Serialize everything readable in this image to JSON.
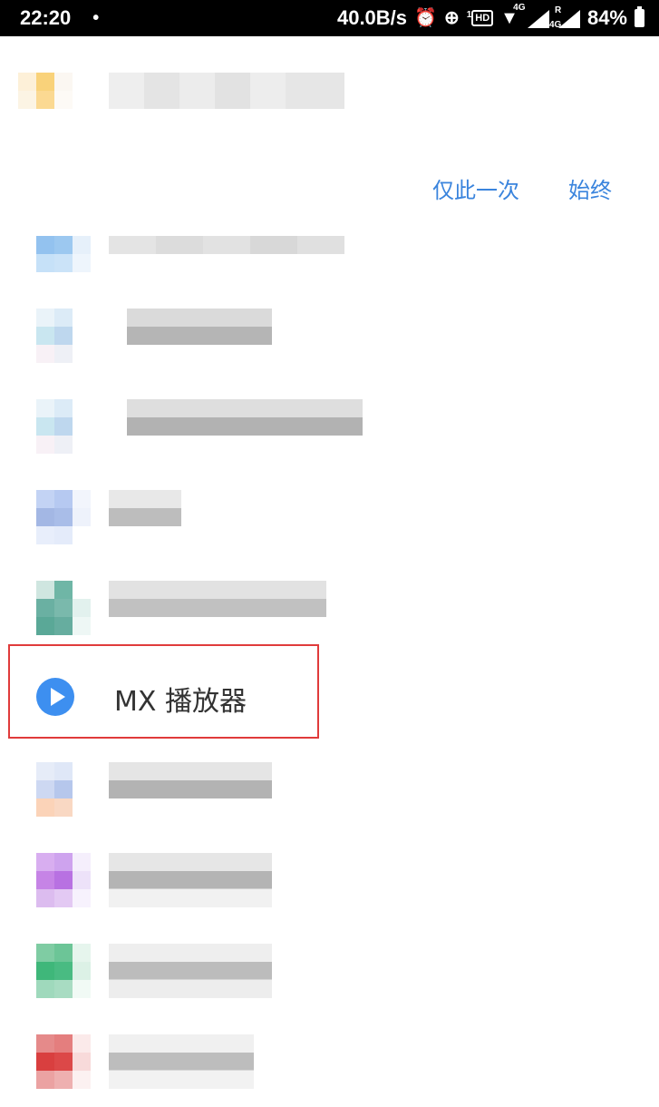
{
  "status_bar": {
    "time": "22:20",
    "dot": "•",
    "speed": "40.0B/s",
    "alarm_icon": "alarm-icon",
    "data_saver_icon": "data-saver-icon",
    "hd_badge_num": "1",
    "hd_badge": "HD",
    "wifi_icon": "wifi-icon",
    "net1_tag": "4G",
    "net2_tag": "4G",
    "roaming_tag": "R",
    "battery": "84%"
  },
  "dialog": {
    "just_once": "仅此一次",
    "always": "始终"
  },
  "apps": [
    {
      "name": "MX 播放器",
      "icon": "play-icon",
      "highlighted": true
    }
  ],
  "colors": {
    "accent": "#3a84dd",
    "highlight_border": "#e03b3b",
    "mx_icon": "#3d8ff0"
  }
}
